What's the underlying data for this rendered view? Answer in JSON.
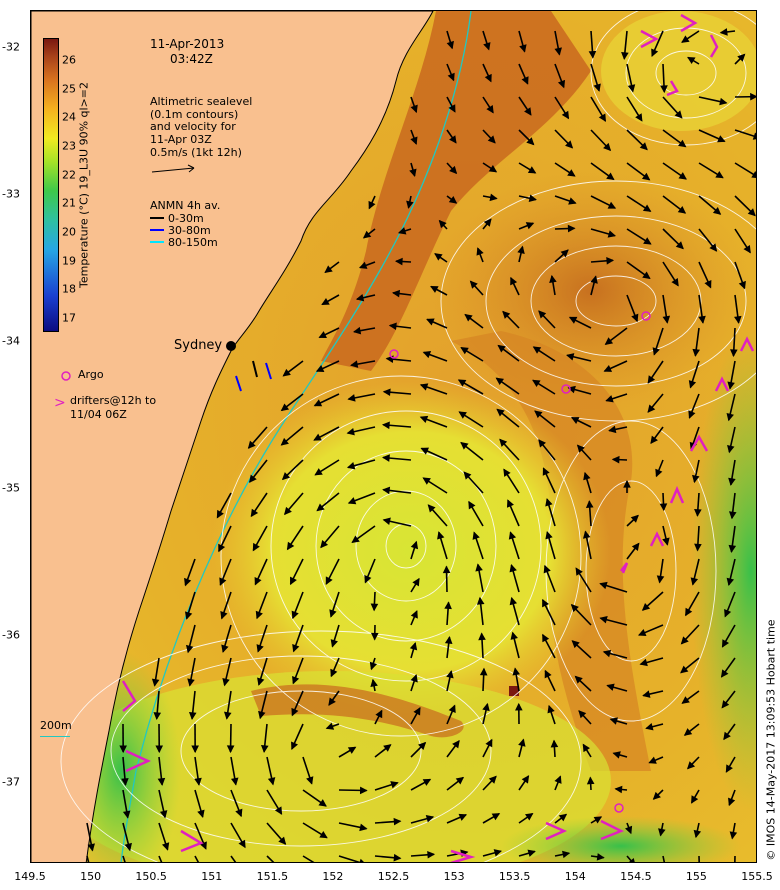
{
  "header": {
    "date": "11-Apr-2013",
    "time": "03:42Z"
  },
  "info_block": {
    "lines": [
      "Altimetric sealevel",
      "(0.1m contours)",
      "and velocity for",
      "11-Apr 03Z",
      "0.5m/s (1kt 12h)"
    ]
  },
  "anmn_legend": {
    "title": "ANMN 4h av.",
    "items": [
      {
        "label": "0-30m",
        "color": "#000000"
      },
      {
        "label": "30-80m",
        "color": "#0000ff"
      },
      {
        "label": "80-150m",
        "color": "#00e5ff"
      }
    ]
  },
  "place_label": "Sydney",
  "argo_legend": {
    "label": "Argo",
    "color": "#e020c0"
  },
  "drifter_legend": {
    "symbol": ">",
    "line1": "drifters@12h to",
    "line2": "11/04 06Z",
    "color": "#e020c0"
  },
  "isobath_label": "200m",
  "colorbar": {
    "title": "Temperature (°C) 19_L3U 90% ql>=2",
    "ticks": [
      "26",
      "25",
      "24",
      "23",
      "22",
      "21",
      "20",
      "19",
      "18",
      "17"
    ]
  },
  "side_credit": "© IMOS 14-May-2017 13:09:53 Hobart time",
  "axes": {
    "x_ticks": [
      "149.5",
      "150",
      "150.5",
      "151",
      "151.5",
      "152",
      "152.5",
      "153",
      "153.5",
      "154",
      "154.5",
      "155",
      "155.5"
    ],
    "y_ticks": [
      "-32",
      "-33",
      "-34",
      "-35",
      "-36",
      "-37"
    ],
    "xlim": [
      149.5,
      155.5
    ],
    "ylim": [
      -37.55,
      -31.75
    ]
  },
  "colors": {
    "land": "#f9c08f",
    "ocean_warm": "#e09a2a",
    "ocean_core": "#c8661f",
    "ocean_cool": "#e8d830",
    "ocean_green": "#5ccb3c",
    "contour": "#ffffff",
    "isobath": "#22c8c0",
    "vector": "#000000",
    "drifter": "#e020c0"
  }
}
